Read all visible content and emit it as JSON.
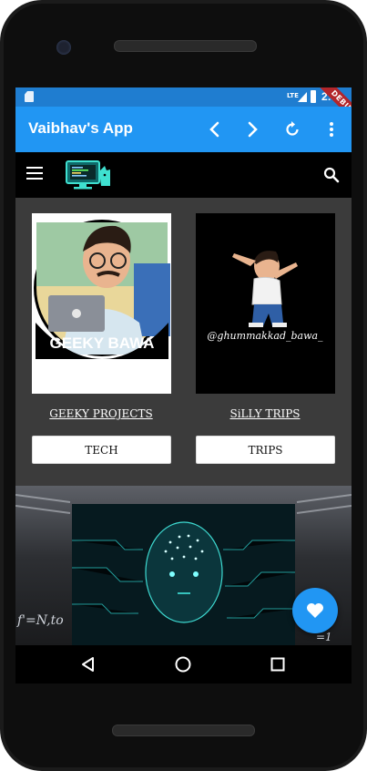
{
  "status_bar": {
    "time": "2:50",
    "network": "LTE",
    "debug_label": "DEBUG"
  },
  "app_bar": {
    "title": "Vaibhav's App",
    "icons": [
      "arrow-back-icon",
      "arrow-forward-icon",
      "refresh-icon",
      "more-vert-icon"
    ]
  },
  "top_nav": {
    "icons": [
      "menu-icon",
      "logo-image",
      "search-icon"
    ]
  },
  "cards": [
    {
      "image_caption": "GEEKY BAWA",
      "link_label": "GEEKY PROJECTS",
      "button_label": "TECH"
    },
    {
      "image_caption": "@ghummakkad_bawa_",
      "link_label": "SiLLY TRIPS",
      "button_label": "TRIPS"
    }
  ],
  "banner": {
    "overlay_text_left": "f'=N,to",
    "overlay_text_right": "=1"
  },
  "fab": {
    "icon": "heart-icon"
  },
  "nav_bar": {
    "icons": [
      "back-triangle-icon",
      "home-circle-icon",
      "recents-square-icon"
    ]
  },
  "colors": {
    "primary": "#2196f3",
    "status_bar": "#1f7dd0",
    "card_background": "#3b3b3b"
  }
}
